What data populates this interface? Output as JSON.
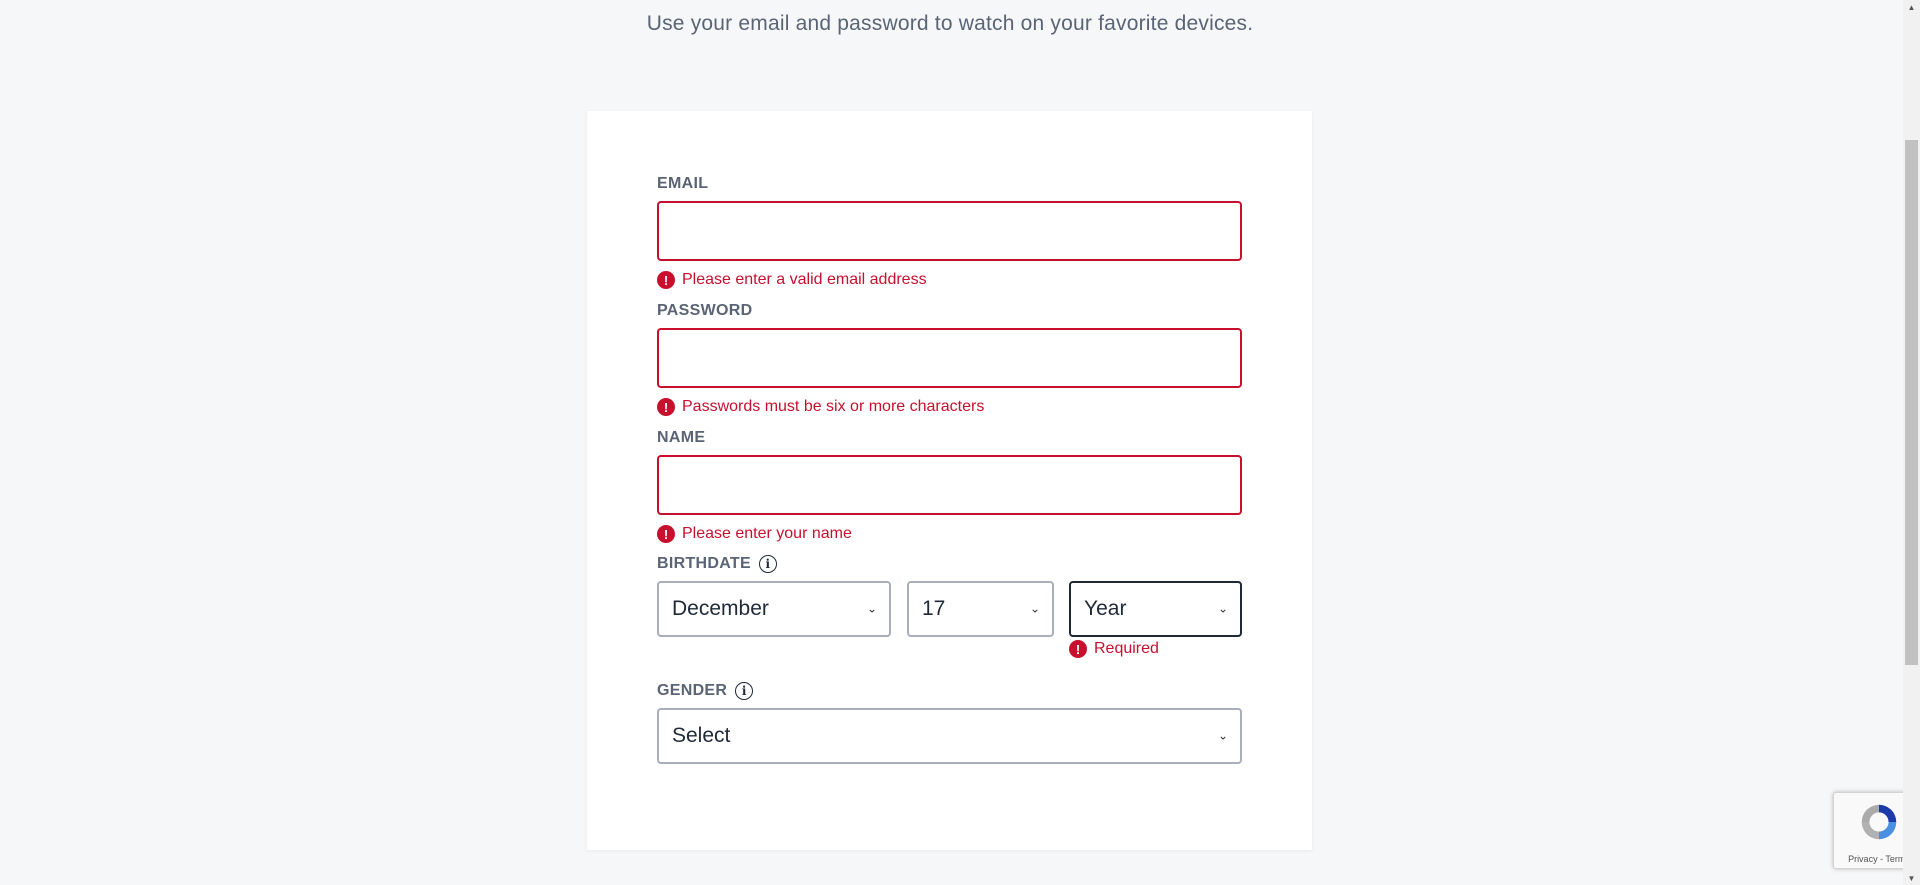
{
  "header": {
    "subtitle": "Use your email and password to watch on your favorite devices."
  },
  "form": {
    "email": {
      "label": "EMAIL",
      "value": "",
      "error": "Please enter a valid email address"
    },
    "password": {
      "label": "PASSWORD",
      "value": "",
      "error": "Passwords must be six or more characters"
    },
    "name": {
      "label": "NAME",
      "value": "",
      "error": "Please enter your name"
    },
    "birthdate": {
      "label": "BIRTHDATE",
      "month": "December",
      "day": "17",
      "year": "Year",
      "year_error": "Required"
    },
    "gender": {
      "label": "GENDER",
      "value": "Select"
    }
  },
  "recaptcha": {
    "privacy": "Privacy",
    "separator": " - ",
    "terms": "Terms"
  },
  "colors": {
    "error": "#c8102e",
    "label": "#5b6475",
    "background": "#f6f7f9"
  }
}
